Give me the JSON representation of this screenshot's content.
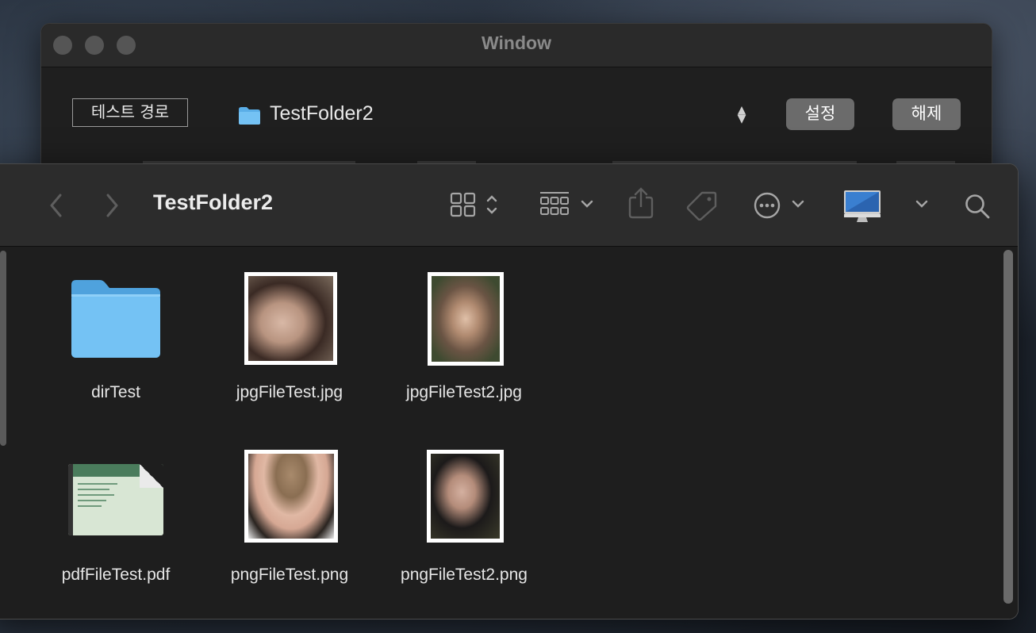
{
  "back_window": {
    "title": "Window",
    "path_label": "테스트 경로",
    "path_name": "TestFolder2",
    "set_button": "설정",
    "clear_button": "해제"
  },
  "finder": {
    "folder_title": "TestFolder2",
    "items": [
      {
        "name": "dirTest",
        "kind": "folder"
      },
      {
        "name": "jpgFileTest.jpg",
        "kind": "image"
      },
      {
        "name": "jpgFileTest2.jpg",
        "kind": "image"
      },
      {
        "name": "pdfFileTest.pdf",
        "kind": "pdf"
      },
      {
        "name": "pngFileTest.png",
        "kind": "image"
      },
      {
        "name": "pngFileTest2.png",
        "kind": "image"
      }
    ]
  },
  "colors": {
    "folder_blue": "#6cbcf0",
    "button_gray": "#6b6b6b",
    "window_bg": "#1e1e1e"
  }
}
